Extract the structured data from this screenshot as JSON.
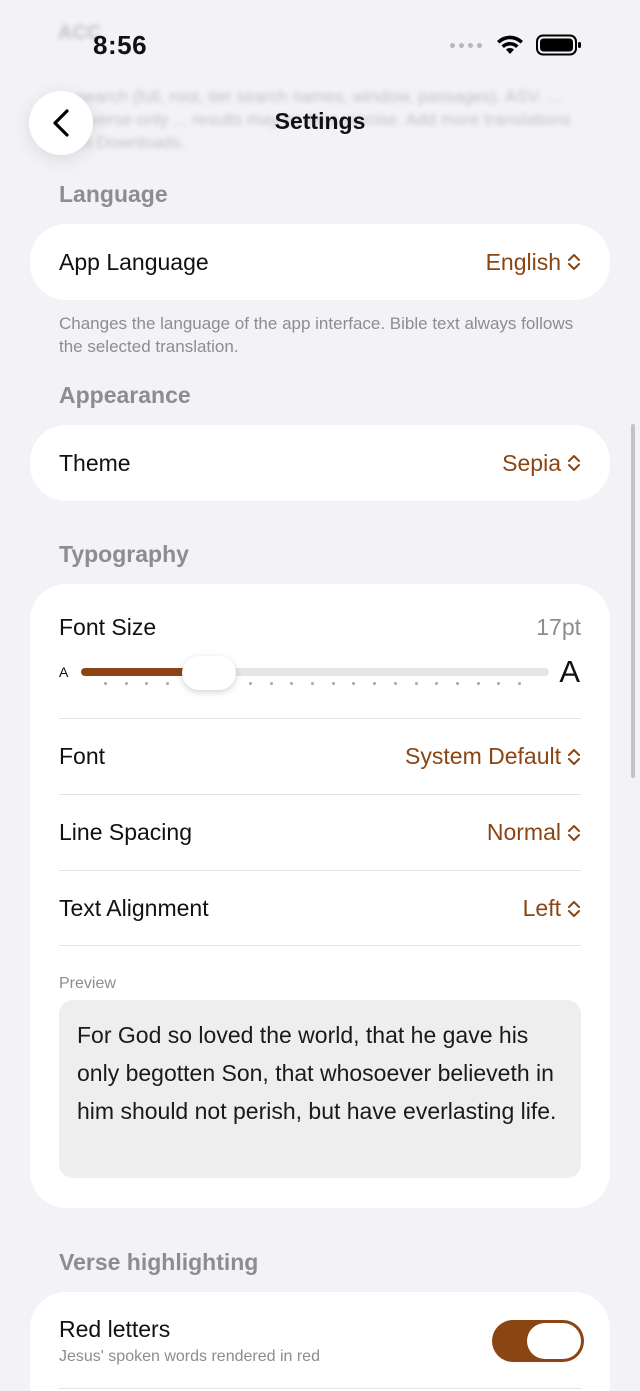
{
  "status_bar": {
    "time": "8:56"
  },
  "background_text": {
    "heading": "ACC",
    "text": "... search (full, root, tier search names, window, passages). ASV. ... use verse-only ... results may be less precise. Add more translations from Downloads."
  },
  "nav": {
    "title": "Settings",
    "back_icon": "chevron-left-icon"
  },
  "language": {
    "header": "Language",
    "app_language_label": "App Language",
    "app_language_value": "English",
    "footnote": "Changes the language of the app interface. Bible text always follows the selected translation."
  },
  "appearance": {
    "header": "Appearance",
    "theme_label": "Theme",
    "theme_value": "Sepia"
  },
  "typography": {
    "header": "Typography",
    "font_size_label": "Font Size",
    "font_size_value": "17pt",
    "slider_small_label": "A",
    "slider_large_label": "A",
    "slider_level": 0.28,
    "font_label": "Font",
    "font_value": "System Default",
    "line_spacing_label": "Line Spacing",
    "line_spacing_value": "Normal",
    "text_alignment_label": "Text Alignment",
    "text_alignment_value": "Left",
    "preview_label": "Preview",
    "preview_text": "For God so loved the world, that he gave his only begotten Son, that whosoever believeth in him should not perish, but have everlasting life."
  },
  "verse_highlighting": {
    "header": "Verse highlighting",
    "red_letters_label": "Red letters",
    "red_letters_subtitle": "Jesus' spoken words rendered in red",
    "red_letters_on": true
  },
  "colors": {
    "accent": "#8b4513",
    "background": "#f2f2f7",
    "card": "#ffffff"
  }
}
